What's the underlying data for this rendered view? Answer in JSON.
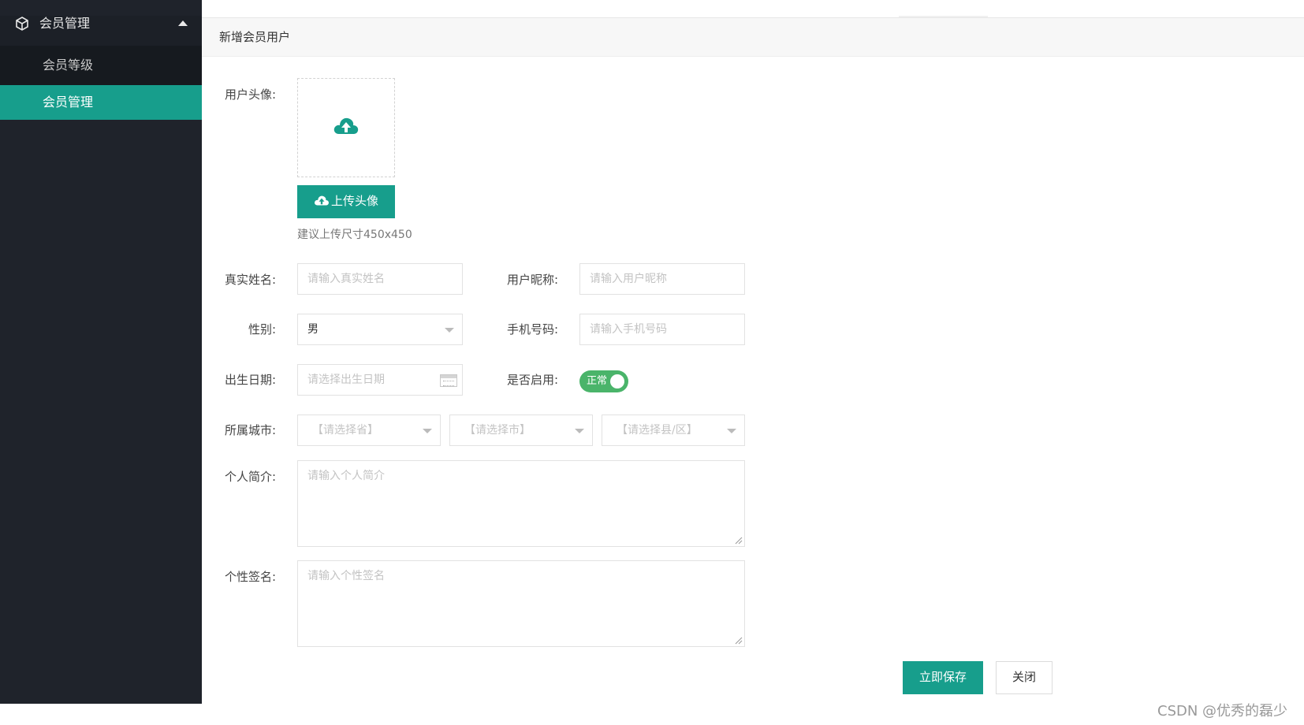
{
  "sidebar": {
    "section_title": "会员管理",
    "items": [
      {
        "label": "会员等级",
        "active": false
      },
      {
        "label": "会员管理",
        "active": true
      }
    ]
  },
  "page": {
    "title": "新增会员用户"
  },
  "form": {
    "avatar": {
      "label": "用户头像:",
      "upload_button": "上传头像",
      "hint": "建议上传尺寸450x450"
    },
    "real_name": {
      "label": "真实姓名:",
      "placeholder": "请输入真实姓名"
    },
    "nickname": {
      "label": "用户昵称:",
      "placeholder": "请输入用户昵称"
    },
    "gender": {
      "label": "性别:",
      "value": "男"
    },
    "phone": {
      "label": "手机号码:",
      "placeholder": "请输入手机号码"
    },
    "birthday": {
      "label": "出生日期:",
      "placeholder": "请选择出生日期"
    },
    "enabled": {
      "label": "是否启用:",
      "value": "正常",
      "on": true
    },
    "city": {
      "label": "所属城市:",
      "province": "【请选择省】",
      "city": "【请选择市】",
      "district": "【请选择县/区】"
    },
    "bio": {
      "label": "个人简介:",
      "placeholder": "请输入个人简介"
    },
    "signature": {
      "label": "个性签名:",
      "placeholder": "请输入个性签名"
    }
  },
  "actions": {
    "save": "立即保存",
    "close": "关闭"
  },
  "watermark": "CSDN @优秀的磊少",
  "colors": {
    "primary": "#179e8c",
    "sidebar": "#1f232b",
    "toggle_on": "#4ab46a"
  }
}
